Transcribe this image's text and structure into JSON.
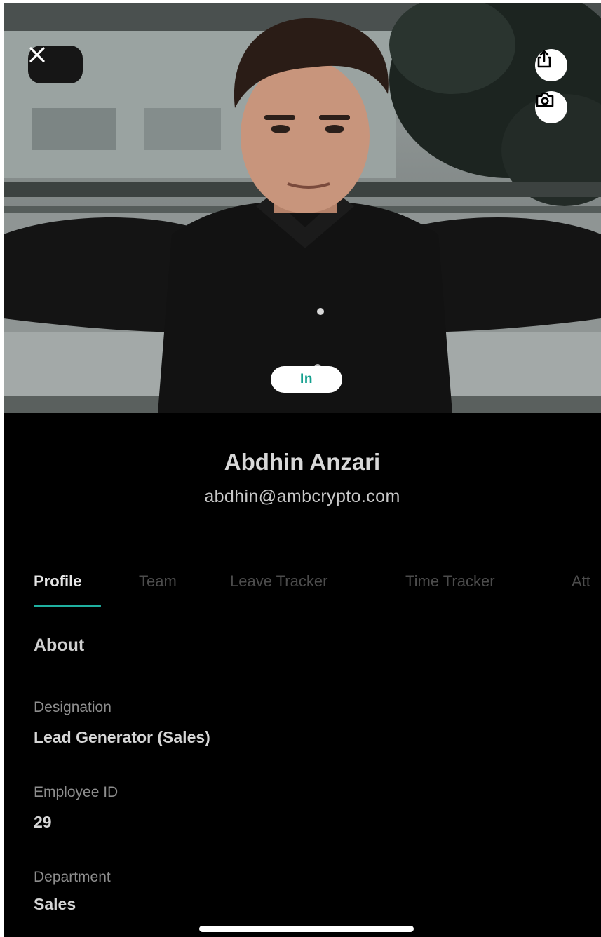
{
  "header": {
    "close_icon": "close-icon",
    "share_icon": "share-icon",
    "camera_icon": "camera-icon",
    "status_label": "In",
    "status_color": "#14a08e"
  },
  "profile": {
    "name": "Abdhin Anzari",
    "email": "abdhin@ambcrypto.com"
  },
  "tabs": [
    {
      "label": "Profile",
      "active": true
    },
    {
      "label": "Team",
      "active": false
    },
    {
      "label": "Leave Tracker",
      "active": false
    },
    {
      "label": "Time Tracker",
      "active": false
    },
    {
      "label": "Att",
      "active": false
    }
  ],
  "about": {
    "title": "About",
    "fields": [
      {
        "label": "Designation",
        "value": "Lead Generator (Sales)"
      },
      {
        "label": "Employee ID",
        "value": "29"
      },
      {
        "label": "Department",
        "value": "Sales"
      }
    ]
  },
  "colors": {
    "accent": "#1fb0a0",
    "background": "#000000"
  }
}
